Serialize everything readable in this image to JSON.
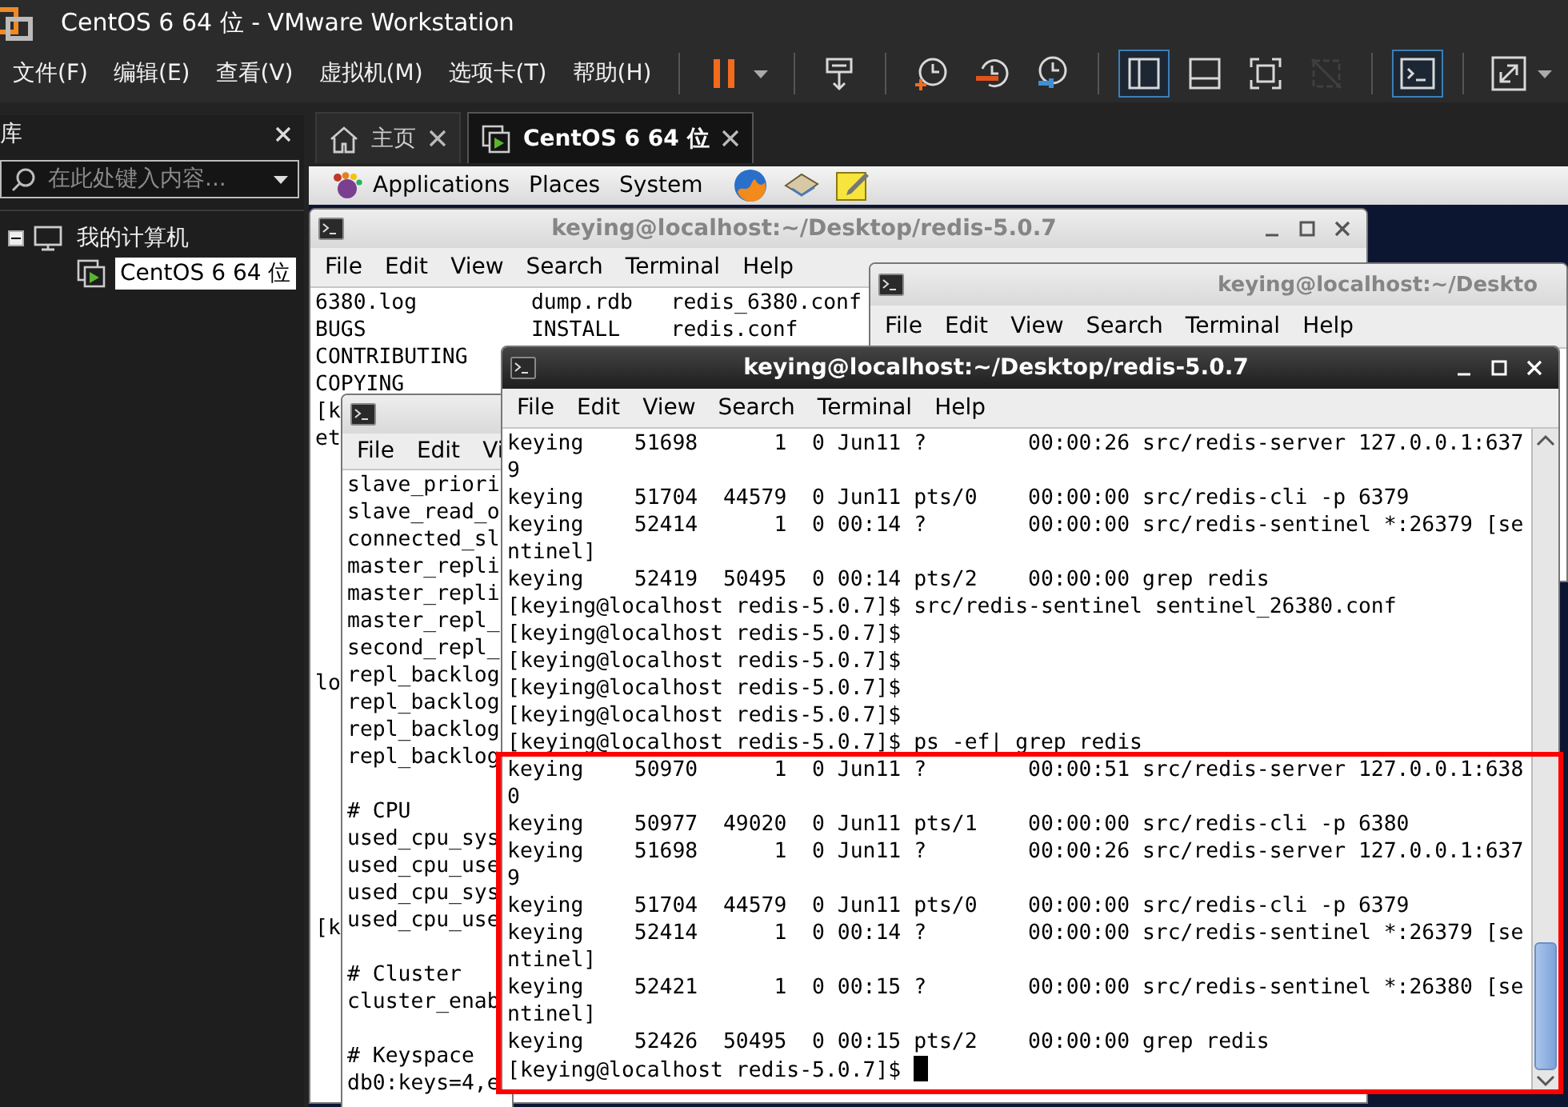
{
  "window": {
    "title": "CentOS 6 64 位 - VMware Workstation"
  },
  "menu": [
    "文件(F)",
    "编辑(E)",
    "查看(V)",
    "虚拟机(M)",
    "选项卡(T)",
    "帮助(H)"
  ],
  "toolbar": [
    [
      {
        "kind": "pause",
        "selected": false,
        "disabled": false
      }
    ],
    [
      {
        "kind": "send-keys",
        "selected": false,
        "disabled": false
      }
    ],
    [
      {
        "kind": "snapshot",
        "selected": false,
        "disabled": false
      },
      {
        "kind": "revert",
        "selected": false,
        "disabled": false
      },
      {
        "kind": "manage-snapshots",
        "selected": false,
        "disabled": false
      }
    ],
    [
      {
        "kind": "sidebar-view",
        "selected": true,
        "disabled": false
      },
      {
        "kind": "thumbnail-view",
        "selected": false,
        "disabled": false
      },
      {
        "kind": "fullscreen",
        "selected": false,
        "disabled": false
      },
      {
        "kind": "unity",
        "selected": false,
        "disabled": true
      }
    ],
    [
      {
        "kind": "console",
        "selected": true,
        "disabled": false
      }
    ],
    [
      {
        "kind": "stretch",
        "selected": false,
        "disabled": false
      }
    ]
  ],
  "library": {
    "title": "库",
    "search": {
      "placeholder": "在此处键入内容..."
    },
    "tree": [
      {
        "label": "我的计算机",
        "expanded": true,
        "selected": false,
        "children": [
          {
            "label": "CentOS 6 64 位",
            "selected": true
          }
        ]
      }
    ]
  },
  "tabs": [
    {
      "label": "主页",
      "kind": "home",
      "selected": false
    },
    {
      "label": "CentOS 6 64 位",
      "kind": "vm",
      "selected": true
    }
  ],
  "guest_panel": {
    "menus": [
      {
        "label": "Applications",
        "kind": "apps"
      },
      {
        "label": "Places",
        "kind": "plain"
      },
      {
        "label": "System",
        "kind": "plain"
      }
    ],
    "launchers": [
      {
        "kind": "browser"
      },
      {
        "kind": "mail"
      },
      {
        "kind": "notes"
      }
    ]
  },
  "terminals": [
    {
      "title": "keying@localhost:~/Desktop/redis-5.0.7",
      "active": false,
      "controls": true,
      "scrollbar": false,
      "cursor": false,
      "menu": [
        "File",
        "Edit",
        "View",
        "Search",
        "Terminal",
        "Help"
      ],
      "sections": [
        [
          "6380.log         dump.rdb   redis_6380.conf",
          "BUGS             INSTALL    redis.conf",
          "CONTRIBUTING",
          "COPYING",
          "[k",
          "et"
        ],
        [
          "lo"
        ],
        [
          "[k"
        ]
      ]
    },
    {
      "title": "keying@localhost:~/Deskto",
      "active": false,
      "controls": false,
      "scrollbar": false,
      "cursor": false,
      "menu": [
        "File",
        "Edit",
        "View",
        "Search",
        "Terminal",
        "Help"
      ]
    },
    {
      "active": false,
      "controls": false,
      "scrollbar": false,
      "cursor": false,
      "menu": [
        "File",
        "Edit",
        "Vi"
      ],
      "sections": [
        [
          "slave_priori",
          "slave_read_o",
          "connected_sl",
          "master_repli",
          "master_repli",
          "master_repl_",
          "second_repl_",
          "repl_backlog",
          "repl_backlog",
          "repl_backlog",
          "repl_backlog"
        ],
        [
          "# CPU",
          "used_cpu_sys",
          "used_cpu_use",
          "used_cpu_sys",
          "used_cpu_use"
        ],
        [
          "# Cluster",
          "cluster_enab"
        ],
        [
          "# Keyspace",
          "db0:keys=4,e"
        ]
      ]
    },
    {
      "title": "keying@localhost:~/Desktop/redis-5.0.7",
      "active": true,
      "controls": true,
      "scrollbar": true,
      "cursor": true,
      "menu": [
        "File",
        "Edit",
        "View",
        "Search",
        "Terminal",
        "Help"
      ],
      "sections": [
        [
          "keying    51698      1  0 Jun11 ?        00:00:26 src/redis-server 127.0.0.1:637",
          "9",
          "keying    51704  44579  0 Jun11 pts/0    00:00:00 src/redis-cli -p 6379",
          "keying    52414      1  0 00:14 ?        00:00:00 src/redis-sentinel *:26379 [se",
          "ntinel]",
          "keying    52419  50495  0 00:14 pts/2    00:00:00 grep redis",
          "[keying@localhost redis-5.0.7]$ src/redis-sentinel sentinel_26380.conf",
          "[keying@localhost redis-5.0.7]$",
          "[keying@localhost redis-5.0.7]$",
          "[keying@localhost redis-5.0.7]$",
          "[keying@localhost redis-5.0.7]$",
          "[keying@localhost redis-5.0.7]$ ps -ef| grep redis",
          "keying    50970      1  0 Jun11 ?        00:00:51 src/redis-server 127.0.0.1:638",
          "0",
          "keying    50977  49020  0 Jun11 pts/1    00:00:00 src/redis-cli -p 6380",
          "keying    51698      1  0 Jun11 ?        00:00:26 src/redis-server 127.0.0.1:637",
          "9",
          "keying    51704  44579  0 Jun11 pts/0    00:00:00 src/redis-cli -p 6379",
          "keying    52414      1  0 00:14 ?        00:00:00 src/redis-sentinel *:26379 [se",
          "ntinel]",
          "keying    52421      1  0 00:15 ?        00:00:00 src/redis-sentinel *:26380 [se",
          "ntinel]",
          "keying    52426  50495  0 00:15 pts/2    00:00:00 grep redis",
          "[keying@localhost redis-5.0.7]$"
        ]
      ]
    }
  ]
}
